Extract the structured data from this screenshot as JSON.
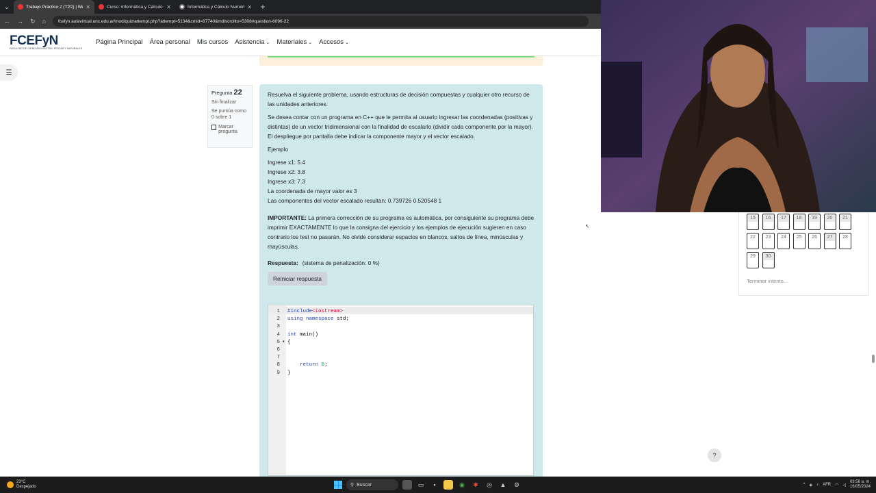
{
  "browser": {
    "tabs": [
      {
        "label": "Trabajo Práctico 2 (TP2) | IWA",
        "active": true
      },
      {
        "label": "Curso: Informática y Cálculo N",
        "active": false
      },
      {
        "label": "Informática y Cálculo Numéric",
        "active": false
      }
    ],
    "url": "fcefyn.aulavirtual.unc.edu.ar/mod/quiz/attempt.php?attempt=5134&cmid=87740&mdlscrollto=5308#question-6096-22"
  },
  "site": {
    "logo_main": "FCEFyN",
    "logo_sub": "FACULTAD DE CIENCIAS EXACTAS, FÍSICAS Y NATURALES",
    "nav": [
      "Página Principal",
      "Área personal",
      "Mis cursos",
      "Asistencia",
      "Materiales",
      "Accesos"
    ]
  },
  "question": {
    "label": "Pregunta",
    "number": "22",
    "status": "Sin finalizar",
    "score": "Se puntúa como 0 sobre 1",
    "flag": "Marcar pregunta",
    "intro": "Resuelva el siguiente problema, usando  estructuras de decisión compuestas y cualquier otro recurso de las unidades anteriores.",
    "statement": "Se desea contar con un programa en C++ que le permita al usuario ingresar las coordenadas (positivas y distintas) de un vector tridimensional con la finalidad de escalarlo (dividir cada componente por la mayor). El despliegue por pantalla debe indicar la componente mayor y el vector escalado.",
    "example_title": "Ejemplo",
    "example_lines": [
      "Ingrese x1: 5.4",
      "Ingrese x2: 3.8",
      "Ingrese x3: 7.3",
      "La coordenada de mayor valor es 3",
      "Las componentes del vector escalado resultan: 0.739726 0.520548 1"
    ],
    "important_label": "IMPORTANTE:",
    "important_text": " La primera corrección de su programa es automática, por consiguiente su programa debe imprimir EXACTAMENTE lo que la consigna del ejercicio y los ejemplos de ejecución sugieren en caso contrario los test no pasarán. No olvide considerar espacios en blancos, saltos de línea, minúsculas y mayúsculas.",
    "answer_label": "Respuesta:",
    "penalty": "(sistema de penalización: 0 %)",
    "reset_button": "Reiniciar respuesta"
  },
  "editor": {
    "lines": [
      {
        "n": "1",
        "fold": "",
        "text": "#include<iostream>"
      },
      {
        "n": "2",
        "fold": "",
        "text": "using namespace std;"
      },
      {
        "n": "3",
        "fold": "",
        "text": ""
      },
      {
        "n": "4",
        "fold": "",
        "text": "int main()"
      },
      {
        "n": "5",
        "fold": "▾",
        "text": "{"
      },
      {
        "n": "6",
        "fold": "",
        "text": ""
      },
      {
        "n": "7",
        "fold": "",
        "text": ""
      },
      {
        "n": "8",
        "fold": "",
        "text": "    return 0;"
      },
      {
        "n": "9",
        "fold": "",
        "text": "}"
      }
    ]
  },
  "quiz_nav": {
    "buttons": [
      "15",
      "16",
      "17",
      "18",
      "19",
      "20",
      "21",
      "22",
      "23",
      "24",
      "25",
      "26",
      "27",
      "28",
      "29",
      "30"
    ],
    "finish": "Terminar intento..."
  },
  "help": "?",
  "taskbar": {
    "temp": "23°C",
    "weather": "Despejado",
    "search": "Buscar",
    "lang": "AFR",
    "time": "03:58 a. m.",
    "date": "16/05/2024"
  }
}
